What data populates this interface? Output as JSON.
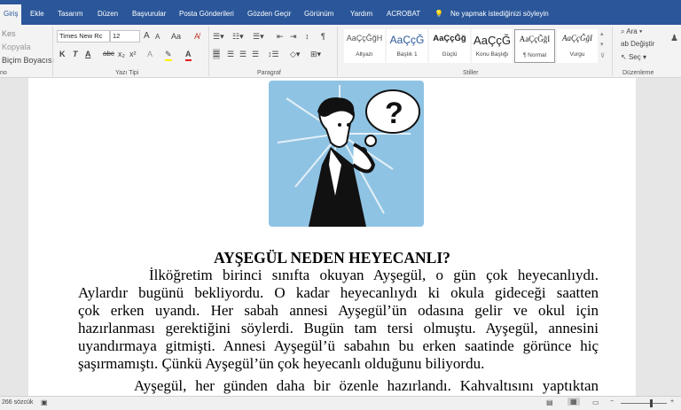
{
  "tabs": [
    "Giriş",
    "Ekle",
    "Tasarım",
    "Düzen",
    "Başvurular",
    "Posta Gönderileri",
    "Gözden Geçir",
    "Görünüm",
    "Yardım",
    "ACROBAT"
  ],
  "tell_me": "Ne yapmak istediğinizi söyleyin",
  "clipboard": {
    "cut": "Kes",
    "copy": "Kopyala",
    "format_painter": "Biçim Boyacısı",
    "label": "no"
  },
  "font": {
    "name": "Times New Rc",
    "size": "12",
    "label": "Yazı Tipi",
    "bold": "K",
    "italic": "T",
    "underline": "A",
    "strike": "abc",
    "sub": "x₂",
    "sup": "x²",
    "grow": "A",
    "shrink": "A",
    "case": "Aa"
  },
  "paragraph": {
    "label": "Paragraf"
  },
  "styles": {
    "label": "Stiller",
    "items": [
      {
        "preview": "AaÇçĞğH",
        "name": "Altyazı"
      },
      {
        "preview": "AaÇçĞ",
        "name": "Başlık 1"
      },
      {
        "preview": "AaÇçĞğ",
        "name": "Güçlü"
      },
      {
        "preview": "AaÇçĞ",
        "name": "Konu Başlığı"
      },
      {
        "preview": "AaÇçĞğI",
        "name": "¶ Normal"
      },
      {
        "preview": "AaÇçĞğI",
        "name": "Vurgu"
      }
    ]
  },
  "editing": {
    "find": "Ara",
    "replace": "Değiştir",
    "select": "Seç",
    "label": "Düzenleme"
  },
  "document": {
    "title": "AYŞEGÜL NEDEN HEYECANLI?",
    "lines": [
      "İlköğretim birinci sınıfta okuyan Ayşegül, o gün çok heyecanlıydı.",
      "Aylardır bugünü bekliyordu. O kadar heyecanlıydı ki okula gideceği saatten",
      "çok erken uyandı. Her sabah annesi Ayşegül’ün odasına gelir ve okul için",
      "hazırlanması gerektiğini söylerdi. Bugün tam tersi olmuştu. Ayşegül, annesini",
      "uyandırmaya gitmişti. Annesi Ayşegül’ü sabahın bu erken saatinde görünce hiç",
      "şaşırmamıştı. Çünkü Ayşegül’ün çok heyecanlı olduğunu biliyordu.",
      "Ayşegül, her günden daha bir özenle hazırlandı. Kahvaltısını yaptıktan"
    ],
    "question_mark": "?"
  },
  "status": {
    "words": "266 sözcük"
  },
  "colors": {
    "ribbon_blue": "#2b579a",
    "picture_bg": "#8fc3e3"
  }
}
